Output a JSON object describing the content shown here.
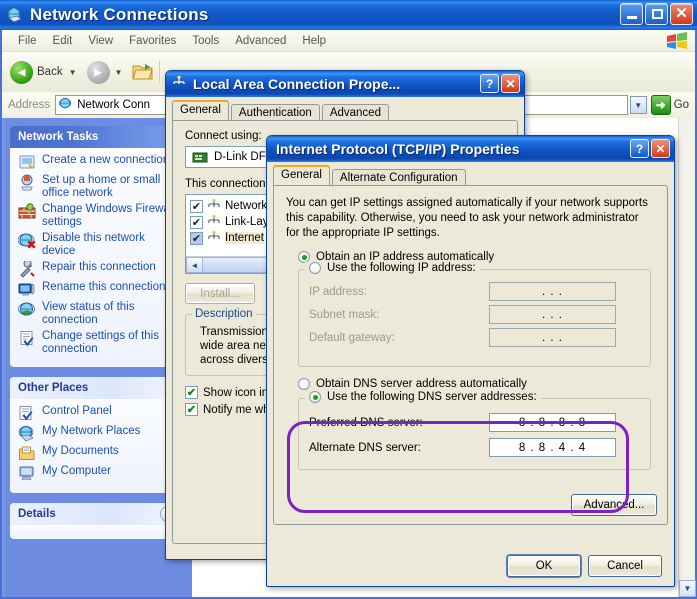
{
  "explorer": {
    "title": "Network Connections",
    "title_icon": "network-globe-icon",
    "window_buttons": {
      "minimize": "_",
      "maximize": "□",
      "close": "✕"
    },
    "menu": [
      "File",
      "Edit",
      "View",
      "Favorites",
      "Tools",
      "Advanced",
      "Help"
    ],
    "toolbar": {
      "back_label": "Back",
      "forward_label": ""
    },
    "address": {
      "label": "Address",
      "value": "Network Conn",
      "go_label": "Go"
    },
    "sidebar": {
      "network_tasks": {
        "title": "Network Tasks",
        "items": [
          {
            "label": "Create a new connection",
            "icon": "new-connection-icon"
          },
          {
            "label": "Set up a home or small office network",
            "icon": "home-network-icon"
          },
          {
            "label": "Change Windows Firewall settings",
            "icon": "firewall-icon"
          },
          {
            "label": "Disable this network device",
            "icon": "disable-device-icon"
          },
          {
            "label": "Repair this connection",
            "icon": "repair-icon"
          },
          {
            "label": "Rename this connection",
            "icon": "rename-icon"
          },
          {
            "label": "View status of this connection",
            "icon": "view-status-icon"
          },
          {
            "label": "Change settings of this connection",
            "icon": "change-settings-icon"
          }
        ]
      },
      "other_places": {
        "title": "Other Places",
        "items": [
          {
            "label": "Control Panel",
            "icon": "control-panel-icon"
          },
          {
            "label": "My Network Places",
            "icon": "my-network-places-icon"
          },
          {
            "label": "My Documents",
            "icon": "my-documents-icon"
          },
          {
            "label": "My Computer",
            "icon": "my-computer-icon"
          }
        ]
      },
      "details": {
        "title": "Details",
        "collapse_glyph": "»"
      }
    }
  },
  "lan_dialog": {
    "title": "Local Area Connection Prope...",
    "title_icon": "network-connection-icon",
    "help_btn": "?",
    "close_btn": "✕",
    "tabs": [
      {
        "label": "General",
        "active": true
      },
      {
        "label": "Authentication",
        "active": false
      },
      {
        "label": "Advanced",
        "active": false
      }
    ],
    "connect_using_label": "Connect using:",
    "adapter": "D-Link DF",
    "components_label": "This connection",
    "components": [
      {
        "label": "Network",
        "checked": true,
        "selected": false
      },
      {
        "label": "Link-Lay",
        "checked": true,
        "selected": false
      },
      {
        "label": "Internet",
        "checked": true,
        "selected": true
      }
    ],
    "install_btn": "Install...",
    "description_group": "Description",
    "description_lines": [
      "Transmission C",
      "wide area netw",
      "across diverse"
    ],
    "checkbox_show_icon": "Show icon in",
    "checkbox_notify": "Notify me whe"
  },
  "tcpip_dialog": {
    "title": "Internet Protocol (TCP/IP) Properties",
    "help_btn": "?",
    "close_btn": "✕",
    "tabs": [
      {
        "label": "General",
        "active": true
      },
      {
        "label": "Alternate Configuration",
        "active": false
      }
    ],
    "intro": "You can get IP settings assigned automatically if your network supports this capability. Otherwise, you need to ask your network administrator for the appropriate IP settings.",
    "ip_auto_label": "Obtain an IP address automatically",
    "ip_manual_label": "Use the following IP address:",
    "ip_fields": [
      {
        "label": "IP address:",
        "value": ".  .  ."
      },
      {
        "label": "Subnet mask:",
        "value": ".  .  ."
      },
      {
        "label": "Default gateway:",
        "value": ".  .  ."
      }
    ],
    "dns_auto_label": "Obtain DNS server address automatically",
    "dns_manual_label": "Use the following DNS server addresses:",
    "dns_fields": [
      {
        "label": "Preferred DNS server:",
        "value": "8 . 8 . 8 . 8"
      },
      {
        "label": "Alternate DNS server:",
        "value": "8 . 8 . 4 . 4"
      }
    ],
    "advanced_btn": "Advanced...",
    "ok_btn": "OK",
    "cancel_btn": "Cancel",
    "highlight_color": "#7b22c7",
    "selected_ip_option": "auto",
    "selected_dns_option": "manual"
  }
}
